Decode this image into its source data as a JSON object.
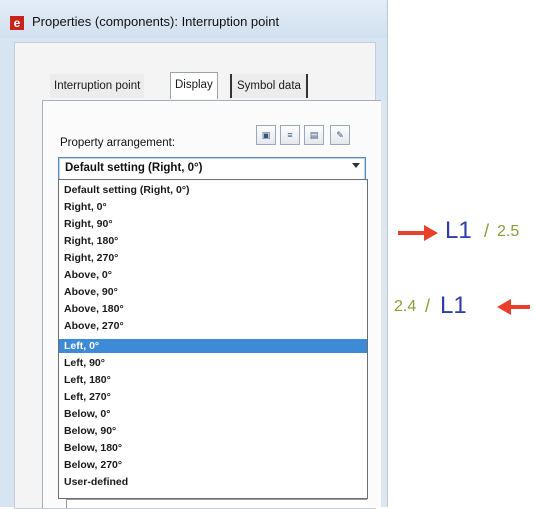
{
  "window": {
    "app_icon_letter": "e",
    "title": "Properties (components): Interruption point"
  },
  "tabs": [
    "Interruption point",
    "Display",
    "Symbol data"
  ],
  "property_arrangement": {
    "label": "Property arrangement:",
    "selected_value": "Default setting (Right, 0°)",
    "options": [
      "Default setting (Right, 0°)",
      "Right, 0°",
      "Right, 90°",
      "Right, 180°",
      "Right, 270°",
      "Above, 0°",
      "Above, 90°",
      "Above, 180°",
      "Above, 270°",
      "Left, 0°",
      "Left, 90°",
      "Left, 180°",
      "Left, 270°",
      "Below, 0°",
      "Below, 90°",
      "Below, 180°",
      "Below, 270°",
      "User-defined"
    ],
    "highlighted_option": "Left, 0°"
  },
  "annotations": {
    "top": {
      "label": "L1",
      "value": "2.5",
      "separator": "/"
    },
    "bottom": {
      "label": "L1",
      "value": "2.4",
      "separator": "/"
    },
    "arrow_color": "#e8402b",
    "label_color": "#2f3da8",
    "value_color": "#8a9a3a"
  }
}
